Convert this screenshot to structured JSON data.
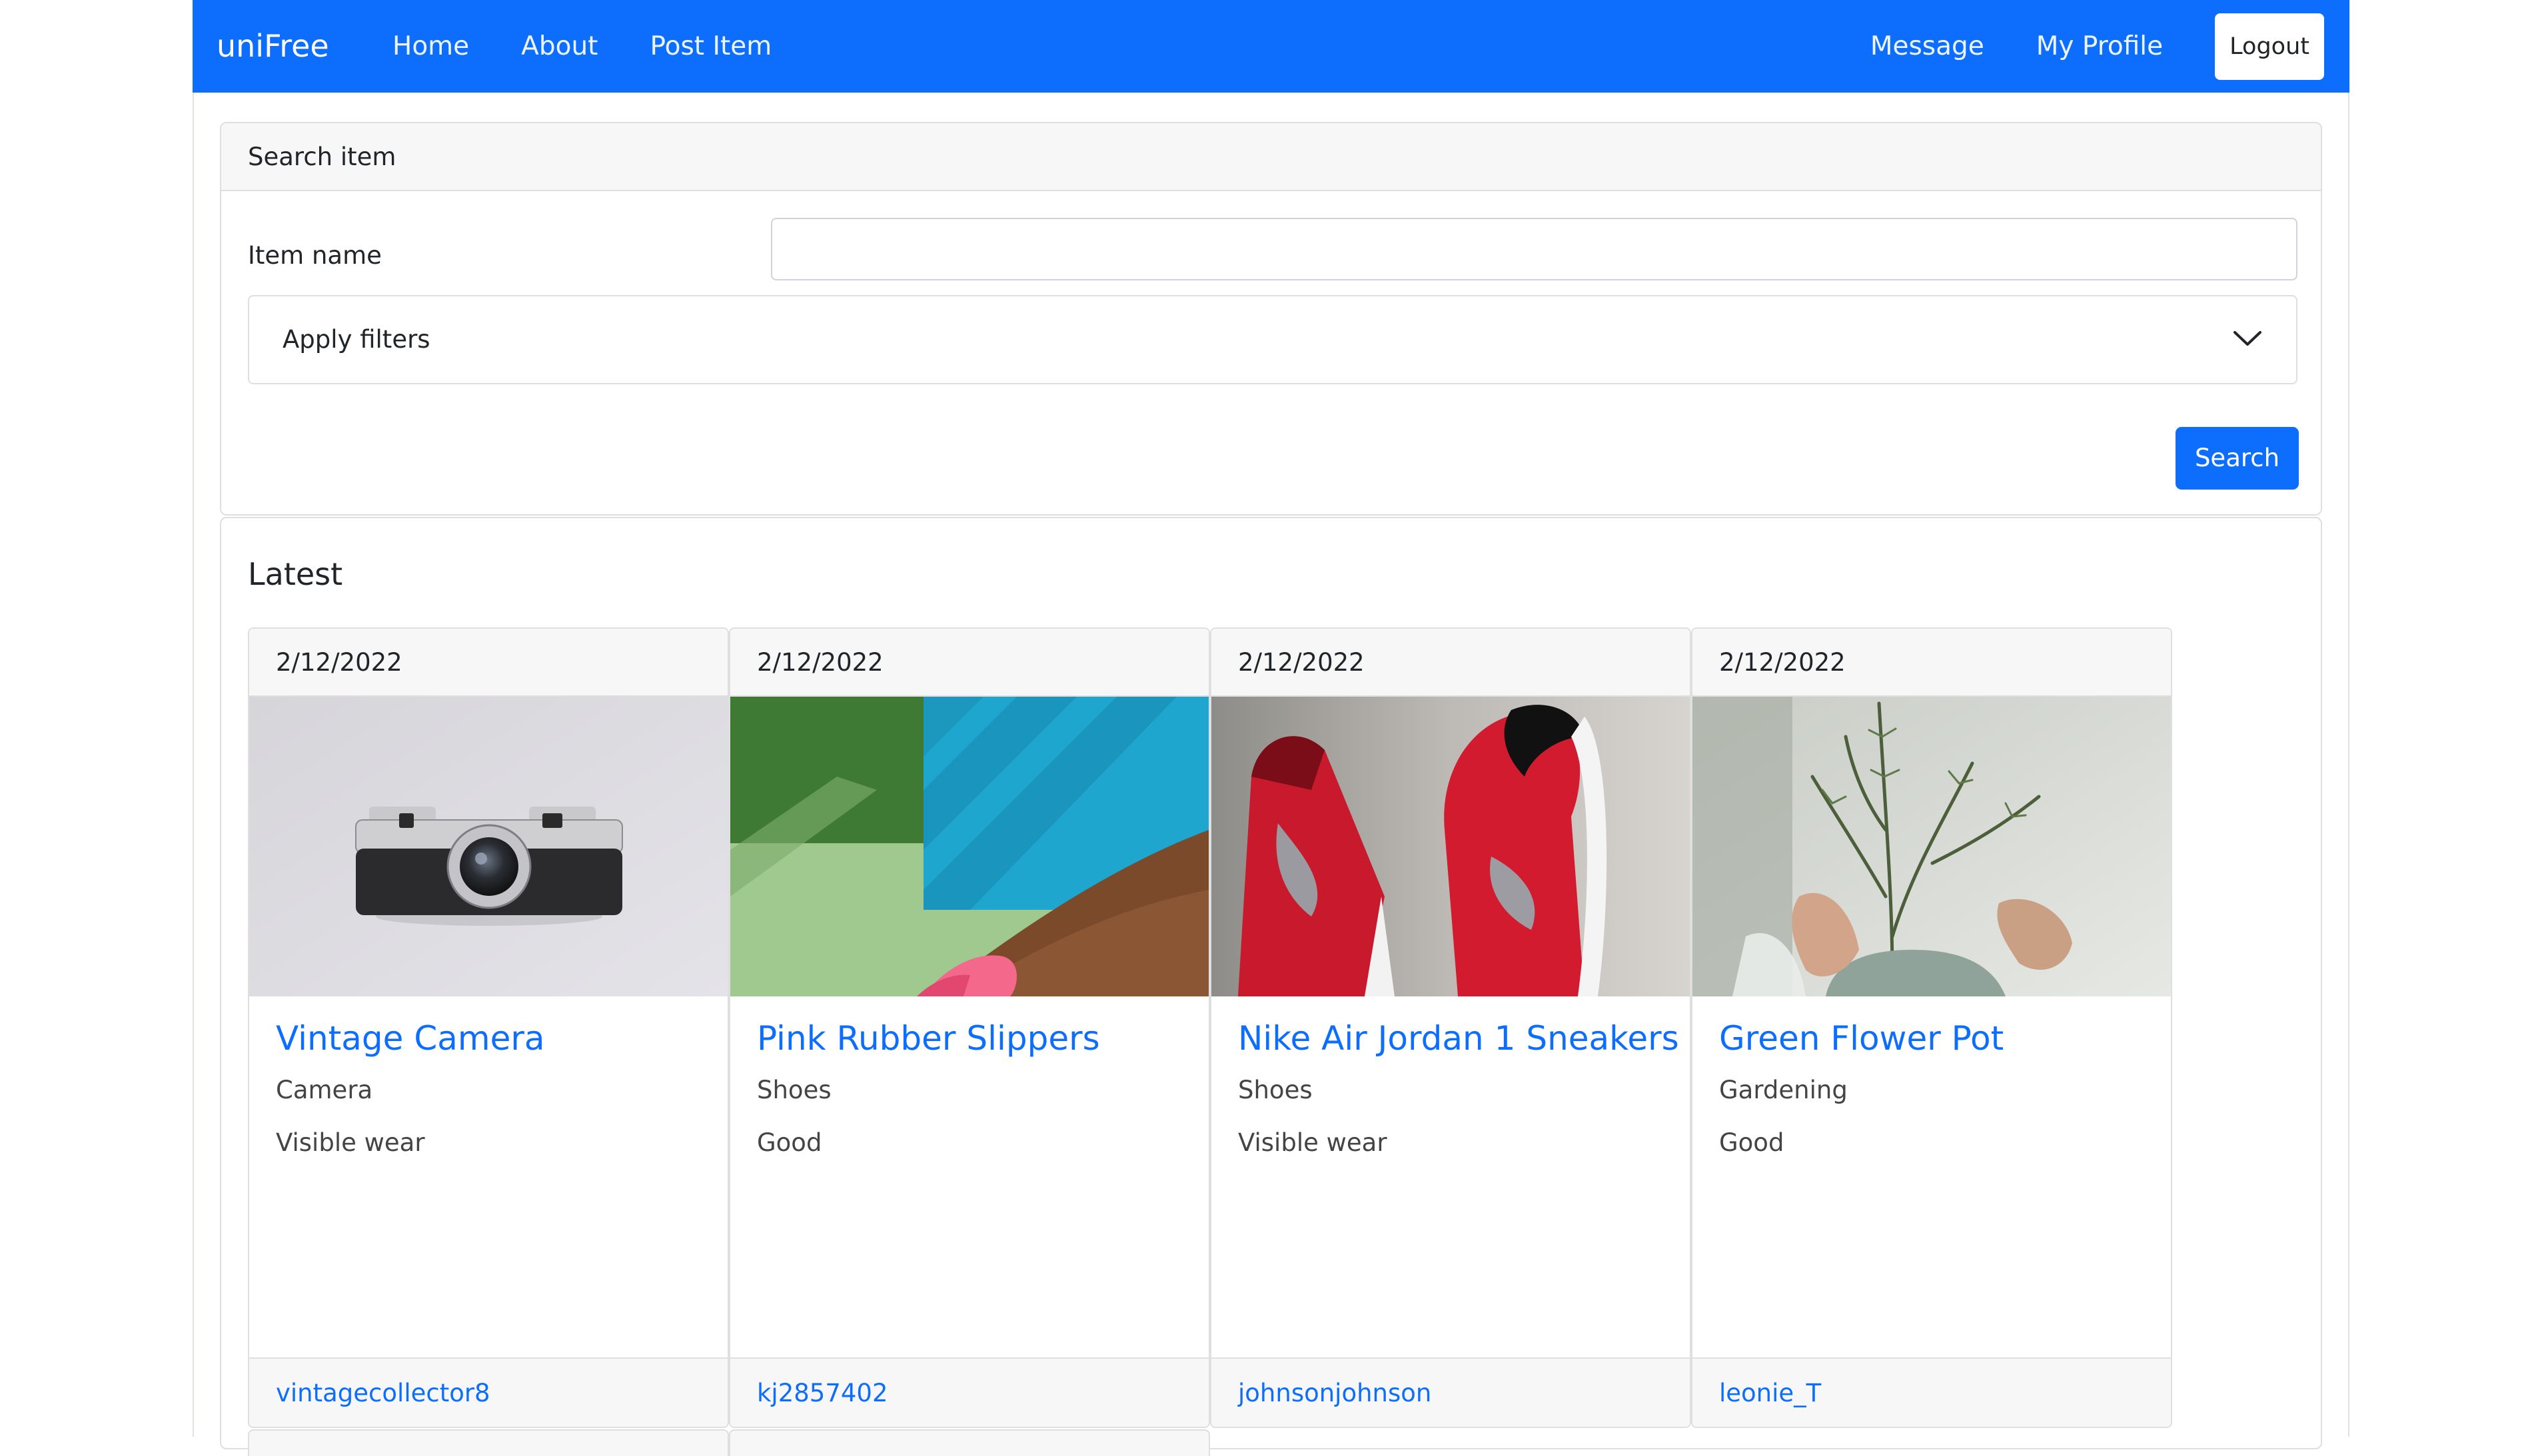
{
  "navbar": {
    "brand": "uniFree",
    "links": [
      "Home",
      "About",
      "Post Item"
    ],
    "right_links": [
      "Message",
      "My Profile"
    ],
    "logout_label": "Logout",
    "color": "#0d6efd"
  },
  "search": {
    "header": "Search item",
    "item_name_label": "Item name",
    "item_name_value": "",
    "filters_label": "Apply filters",
    "filters_icon": "chevron-down-icon",
    "button_label": "Search"
  },
  "latest": {
    "title": "Latest",
    "items": [
      {
        "date": "2/12/2022",
        "title": "Vintage Camera",
        "category": "Camera",
        "condition": "Visible wear",
        "user": "vintagecollector8",
        "image": "camera-photo"
      },
      {
        "date": "2/12/2022",
        "title": "Pink Rubber Slippers",
        "category": "Shoes",
        "condition": "Good",
        "user": "kj2857402",
        "image": "slippers-photo"
      },
      {
        "date": "2/12/2022",
        "title": "Nike Air Jordan 1 Sneakers",
        "category": "Shoes",
        "condition": "Visible wear",
        "user": "johnsonjohnson",
        "image": "sneakers-photo"
      },
      {
        "date": "2/12/2022",
        "title": "Green Flower Pot",
        "category": "Gardening",
        "condition": "Good",
        "user": "leonie_T",
        "image": "plant-photo"
      }
    ]
  }
}
